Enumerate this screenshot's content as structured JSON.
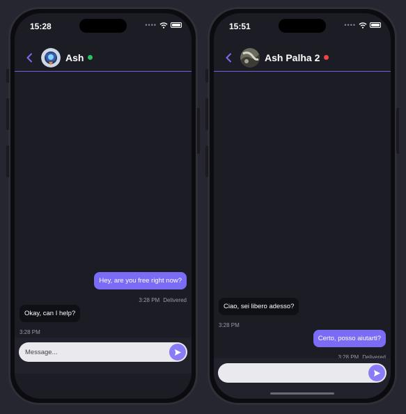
{
  "colors": {
    "accent": "#7b6cf6",
    "online": "#22c55e",
    "offline": "#ef4444",
    "background": "#1c1c24",
    "incoming_bubble": "#0f0f16"
  },
  "left_phone": {
    "status_time": "15:28",
    "contact_name": "Ash",
    "contact_status": "online",
    "avatar_icon": "astronaut-avatar-icon",
    "messages": [
      {
        "direction": "out",
        "text": "Hey, are you free right now?",
        "time": "3:28 PM",
        "status": "Delivered"
      },
      {
        "direction": "in",
        "text": "Okay, can I help?",
        "time": "3:28 PM"
      }
    ],
    "composer": {
      "placeholder": "Message...",
      "value": ""
    }
  },
  "right_phone": {
    "status_time": "15:51",
    "contact_name": "Ash Palha 2",
    "contact_status": "offline",
    "avatar_icon": "photo-avatar-icon",
    "messages": [
      {
        "direction": "in",
        "text": "Ciao, sei libero adesso?",
        "time": "3:28 PM"
      },
      {
        "direction": "out",
        "text": "Certo, posso aiutarti?",
        "time": "3:28 PM",
        "status": "Delivered"
      }
    ],
    "composer": {
      "placeholder": "",
      "value": ""
    }
  }
}
